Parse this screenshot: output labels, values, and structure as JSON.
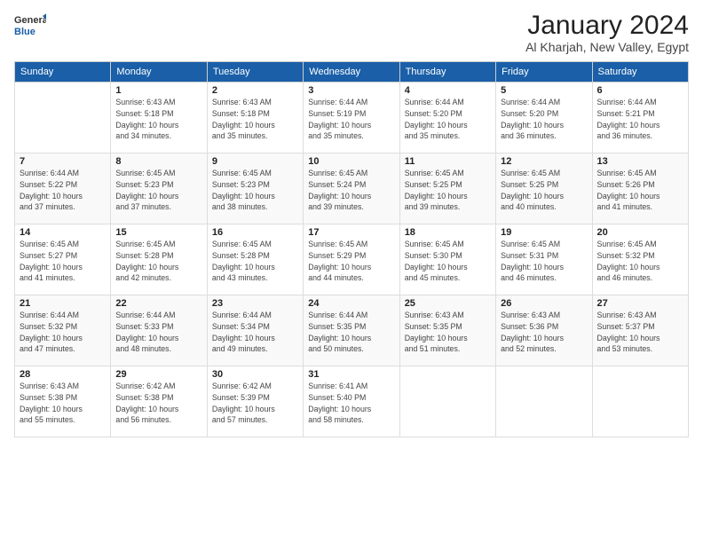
{
  "logo": {
    "line1": "General",
    "line2": "Blue"
  },
  "header": {
    "month": "January 2024",
    "location": "Al Kharjah, New Valley, Egypt"
  },
  "days_of_week": [
    "Sunday",
    "Monday",
    "Tuesday",
    "Wednesday",
    "Thursday",
    "Friday",
    "Saturday"
  ],
  "weeks": [
    [
      {
        "day": "",
        "info": ""
      },
      {
        "day": "1",
        "info": "Sunrise: 6:43 AM\nSunset: 5:18 PM\nDaylight: 10 hours\nand 34 minutes."
      },
      {
        "day": "2",
        "info": "Sunrise: 6:43 AM\nSunset: 5:18 PM\nDaylight: 10 hours\nand 35 minutes."
      },
      {
        "day": "3",
        "info": "Sunrise: 6:44 AM\nSunset: 5:19 PM\nDaylight: 10 hours\nand 35 minutes."
      },
      {
        "day": "4",
        "info": "Sunrise: 6:44 AM\nSunset: 5:20 PM\nDaylight: 10 hours\nand 35 minutes."
      },
      {
        "day": "5",
        "info": "Sunrise: 6:44 AM\nSunset: 5:20 PM\nDaylight: 10 hours\nand 36 minutes."
      },
      {
        "day": "6",
        "info": "Sunrise: 6:44 AM\nSunset: 5:21 PM\nDaylight: 10 hours\nand 36 minutes."
      }
    ],
    [
      {
        "day": "7",
        "info": "Sunrise: 6:44 AM\nSunset: 5:22 PM\nDaylight: 10 hours\nand 37 minutes."
      },
      {
        "day": "8",
        "info": "Sunrise: 6:45 AM\nSunset: 5:23 PM\nDaylight: 10 hours\nand 37 minutes."
      },
      {
        "day": "9",
        "info": "Sunrise: 6:45 AM\nSunset: 5:23 PM\nDaylight: 10 hours\nand 38 minutes."
      },
      {
        "day": "10",
        "info": "Sunrise: 6:45 AM\nSunset: 5:24 PM\nDaylight: 10 hours\nand 39 minutes."
      },
      {
        "day": "11",
        "info": "Sunrise: 6:45 AM\nSunset: 5:25 PM\nDaylight: 10 hours\nand 39 minutes."
      },
      {
        "day": "12",
        "info": "Sunrise: 6:45 AM\nSunset: 5:25 PM\nDaylight: 10 hours\nand 40 minutes."
      },
      {
        "day": "13",
        "info": "Sunrise: 6:45 AM\nSunset: 5:26 PM\nDaylight: 10 hours\nand 41 minutes."
      }
    ],
    [
      {
        "day": "14",
        "info": "Sunrise: 6:45 AM\nSunset: 5:27 PM\nDaylight: 10 hours\nand 41 minutes."
      },
      {
        "day": "15",
        "info": "Sunrise: 6:45 AM\nSunset: 5:28 PM\nDaylight: 10 hours\nand 42 minutes."
      },
      {
        "day": "16",
        "info": "Sunrise: 6:45 AM\nSunset: 5:28 PM\nDaylight: 10 hours\nand 43 minutes."
      },
      {
        "day": "17",
        "info": "Sunrise: 6:45 AM\nSunset: 5:29 PM\nDaylight: 10 hours\nand 44 minutes."
      },
      {
        "day": "18",
        "info": "Sunrise: 6:45 AM\nSunset: 5:30 PM\nDaylight: 10 hours\nand 45 minutes."
      },
      {
        "day": "19",
        "info": "Sunrise: 6:45 AM\nSunset: 5:31 PM\nDaylight: 10 hours\nand 46 minutes."
      },
      {
        "day": "20",
        "info": "Sunrise: 6:45 AM\nSunset: 5:32 PM\nDaylight: 10 hours\nand 46 minutes."
      }
    ],
    [
      {
        "day": "21",
        "info": "Sunrise: 6:44 AM\nSunset: 5:32 PM\nDaylight: 10 hours\nand 47 minutes."
      },
      {
        "day": "22",
        "info": "Sunrise: 6:44 AM\nSunset: 5:33 PM\nDaylight: 10 hours\nand 48 minutes."
      },
      {
        "day": "23",
        "info": "Sunrise: 6:44 AM\nSunset: 5:34 PM\nDaylight: 10 hours\nand 49 minutes."
      },
      {
        "day": "24",
        "info": "Sunrise: 6:44 AM\nSunset: 5:35 PM\nDaylight: 10 hours\nand 50 minutes."
      },
      {
        "day": "25",
        "info": "Sunrise: 6:43 AM\nSunset: 5:35 PM\nDaylight: 10 hours\nand 51 minutes."
      },
      {
        "day": "26",
        "info": "Sunrise: 6:43 AM\nSunset: 5:36 PM\nDaylight: 10 hours\nand 52 minutes."
      },
      {
        "day": "27",
        "info": "Sunrise: 6:43 AM\nSunset: 5:37 PM\nDaylight: 10 hours\nand 53 minutes."
      }
    ],
    [
      {
        "day": "28",
        "info": "Sunrise: 6:43 AM\nSunset: 5:38 PM\nDaylight: 10 hours\nand 55 minutes."
      },
      {
        "day": "29",
        "info": "Sunrise: 6:42 AM\nSunset: 5:38 PM\nDaylight: 10 hours\nand 56 minutes."
      },
      {
        "day": "30",
        "info": "Sunrise: 6:42 AM\nSunset: 5:39 PM\nDaylight: 10 hours\nand 57 minutes."
      },
      {
        "day": "31",
        "info": "Sunrise: 6:41 AM\nSunset: 5:40 PM\nDaylight: 10 hours\nand 58 minutes."
      },
      {
        "day": "",
        "info": ""
      },
      {
        "day": "",
        "info": ""
      },
      {
        "day": "",
        "info": ""
      }
    ]
  ]
}
